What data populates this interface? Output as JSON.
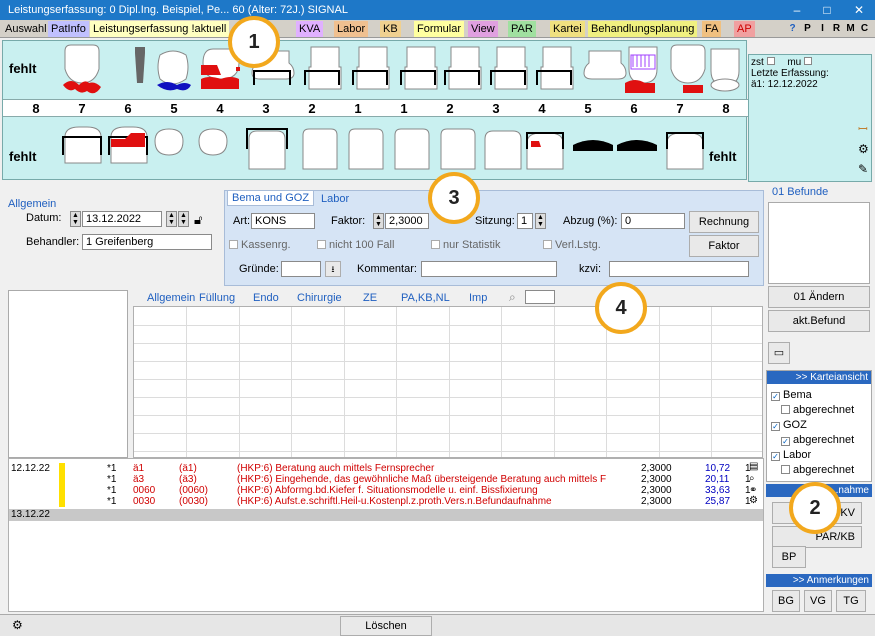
{
  "window": {
    "title": "Leistungserfassung: 0  Dipl.Ing. Beispiel, Pe... 60 (Alter: 72J.)  SIGNAL",
    "minimize": "‒",
    "maximize": "□",
    "close": "✕"
  },
  "tabs": [
    {
      "label": "Auswahl",
      "color": "#d4d0c8"
    },
    {
      "label": "PatInfo",
      "color": "#c0c0ff"
    },
    {
      "label": "Leistungserfassung !aktuell",
      "color": "#ffffc0"
    },
    {
      "label": "KVA",
      "color": "#e0b0ff"
    },
    {
      "label": "Labor",
      "color": "#f0c090"
    },
    {
      "label": "KB",
      "color": "#f0d090"
    },
    {
      "label": "Formular",
      "color": "#ffffa0"
    },
    {
      "label": "View",
      "color": "#e0a0e0"
    },
    {
      "label": "PAR",
      "color": "#a0e0a0"
    },
    {
      "label": "Kartei",
      "color": "#f0e080"
    },
    {
      "label": "Behandlungsplanung",
      "color": "#f0f080"
    },
    {
      "label": "FA",
      "color": "#f0c080"
    },
    {
      "label": "AP",
      "color": "#f0a0a0"
    }
  ],
  "tab_icons": [
    "P",
    "I",
    "R",
    "M",
    "C"
  ],
  "chart": {
    "upper_label_left": "fehlt",
    "lower_label_left": "fehlt",
    "lower_label_right": "fehlt",
    "numbers": [
      "8",
      "7",
      "6",
      "5",
      "4",
      "3",
      "2",
      "1",
      "1",
      "2",
      "3",
      "4",
      "5",
      "6",
      "7",
      "8"
    ]
  },
  "chart_info": {
    "zst": "zst",
    "mu": "mu",
    "last_entry_label": "Letzte Erfassung:",
    "last_entry_value": "ä1: 12.12.2022"
  },
  "allgemein": {
    "title": "Allgemein",
    "date_label": "Datum:",
    "date_value": "13.12.2022",
    "treater_label": "Behandler:",
    "treater_value": "1  Greifenberg"
  },
  "bema_tabs": [
    "Bema und GOZ",
    "Labor"
  ],
  "bema": {
    "art_label": "Art:",
    "art_value": "KONS",
    "faktor_label": "Faktor:",
    "faktor_value": "2,3000",
    "sitzung_label": "Sitzung:",
    "sitzung_value": "1",
    "abzug_label": "Abzug (%):",
    "abzug_value": "0",
    "rechnung_button": "Rechnung",
    "faktor_button": "Faktor",
    "kassenrg": "Kassenrg.",
    "nicht100": "nicht 100 Fall",
    "nurstat": "nur Statistik",
    "verl": "Verl.Lstg.",
    "gruende_label": "Gründe:",
    "kommentar_label": "Kommentar:",
    "kzvi_label": "kzvi:"
  },
  "befunde": {
    "title": "01 Befunde",
    "aendern_button": "01 Ändern",
    "akt_button": "akt.Befund"
  },
  "service_tabs": [
    "Allgemein",
    "Füllung",
    "Endo",
    "Chirurgie",
    "ZE",
    "PA,KB,NL",
    "Imp"
  ],
  "entries": [
    {
      "date": "12.12.22",
      "count": "*1",
      "code": "ä1",
      "code2": "(ä1)",
      "text": "(HKP:6) Beratung auch mittels Fernsprecher",
      "factor": "2,3000",
      "amount": "10,72",
      "qty": "1"
    },
    {
      "date": "",
      "count": "*1",
      "code": "ä3",
      "code2": "(ä3)",
      "text": "(HKP:6) Eingehende, das gewöhnliche Maß übersteigende Beratung auch mittels F",
      "factor": "2,3000",
      "amount": "20,11",
      "qty": "1"
    },
    {
      "date": "",
      "count": "*1",
      "code": "0060",
      "code2": "(0060)",
      "text": "(HKP:6) Abformg.bd.Kiefer f. Situationsmodelle u. einf. Bissfixierung",
      "factor": "2,3000",
      "amount": "33,63",
      "qty": "1"
    },
    {
      "date": "",
      "count": "*1",
      "code": "0030",
      "code2": "(0030)",
      "text": "(HKP:6) Aufst.e.schriftl.Heil-u.Kostenpl.z.proth.Vers.n.Befundaufnahme",
      "factor": "2,3000",
      "amount": "25,87",
      "qty": "1"
    }
  ],
  "entry_date2": "13.12.22",
  "karteiansicht": {
    "title": ">> Karteiansicht",
    "items": [
      {
        "label": "Bema",
        "checked": true,
        "indent": false
      },
      {
        "label": "abgerechnet",
        "checked": false,
        "indent": true
      },
      {
        "label": "GOZ",
        "checked": true,
        "indent": false
      },
      {
        "label": "abgerechnet",
        "checked": true,
        "indent": true
      },
      {
        "label": "Labor",
        "checked": true,
        "indent": false
      },
      {
        "label": "abgerechnet",
        "checked": false,
        "indent": true
      }
    ]
  },
  "uebernahme": {
    "title": "...nahme",
    "buttons": [
      "KV",
      "PAR/KB",
      "BP"
    ]
  },
  "anmerkungen": {
    "title": ">> Anmerkungen",
    "buttons": [
      "BG",
      "VG",
      "TG"
    ]
  },
  "footer": {
    "loeschen": "Löschen"
  },
  "callouts": [
    "1",
    "2",
    "3",
    "4"
  ]
}
